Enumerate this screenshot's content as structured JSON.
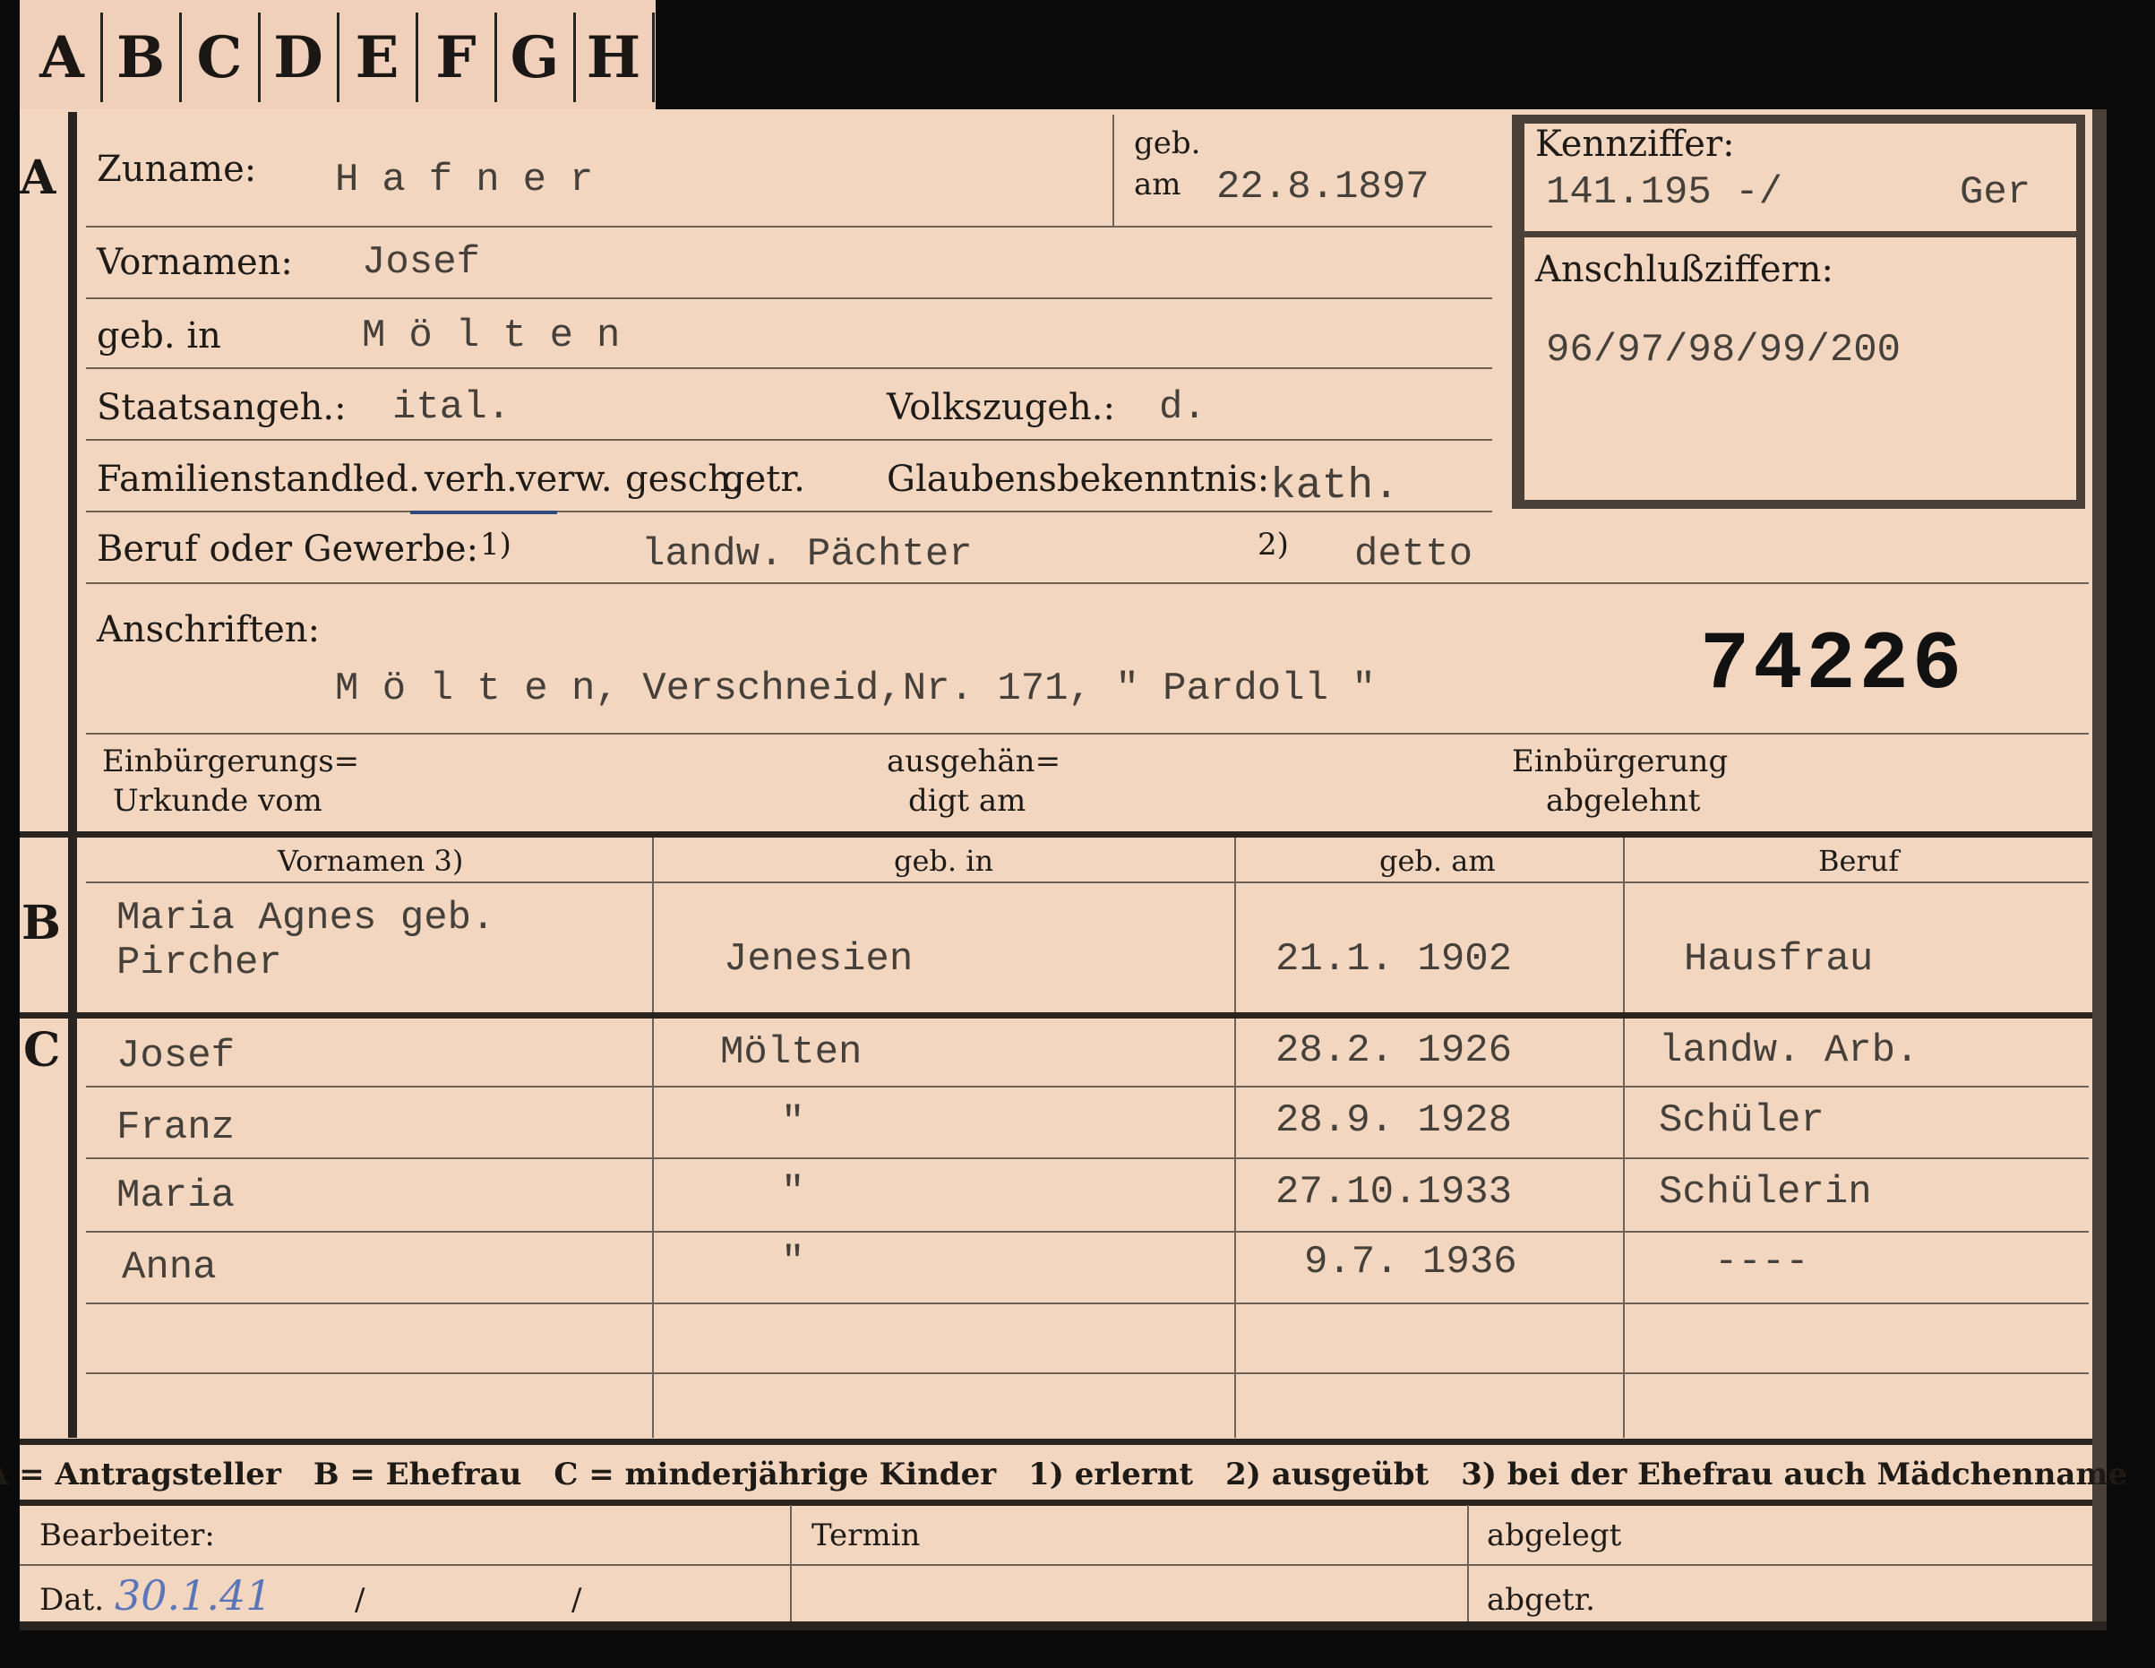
{
  "tabs": [
    "A",
    "B",
    "C",
    "D",
    "E",
    "F",
    "G",
    "H"
  ],
  "sections": {
    "a": "A",
    "b": "B",
    "c": "C"
  },
  "applicant": {
    "zuname_label": "Zuname:",
    "zuname_value": "Hafner",
    "geb_label": "geb.",
    "am_label": "am",
    "geb_am_value": "22.8.1897",
    "vornamen_label": "Vornamen:",
    "vornamen_value": "Josef",
    "geb_in_label": "geb. in",
    "geb_in_value": "Mölten",
    "staatsangeh_label": "Staatsangeh.:",
    "staatsangeh_value": "ital.",
    "volkszugeh_label": "Volkszugeh.:",
    "volkszugeh_value": "d.",
    "familienstand_label": "Familienstand:",
    "familienstand_options": [
      "led.",
      "verh.",
      "verw.",
      "gesch.",
      "getr."
    ],
    "familienstand_selected": "verh.",
    "glaubens_label": "Glaubensbekenntnis:",
    "glaubens_value": "kath.",
    "beruf_label": "Beruf oder Gewerbe:",
    "beruf_mark1": "1)",
    "beruf_value1": "landw. Pächter",
    "beruf_mark2": "2)",
    "beruf_value2": "detto",
    "anschriften_label": "Anschriften:",
    "anschriften_value": "M ö l t e n, Verschneid,Nr. 171, \" Pardoll \"",
    "stamp_number": "74226",
    "einb_urkunde_label_1": "Einbürgerungs=",
    "einb_urkunde_label_2": "Urkunde vom",
    "ausgehaendigt_label_1": "ausgehän=",
    "ausgehaendigt_label_2": "digt am",
    "einb_abgelehnt_label_1": "Einbürgerung",
    "einb_abgelehnt_label_2": "abgelehnt"
  },
  "box": {
    "kennziffer_label": "Kennziffer:",
    "kennziffer_value": "141.195 -/",
    "kennziffer_suffix": "Ger",
    "anschluss_label": "Anschlußziffern:",
    "anschluss_value": "96/97/98/99/200"
  },
  "table": {
    "headers": [
      "Vornamen 3)",
      "geb. in",
      "geb. am",
      "Beruf"
    ],
    "spouse": {
      "vornamen_1": "Maria Agnes geb.",
      "vornamen_2": "Pircher",
      "geb_in": "Jenesien",
      "geb_am": "21.1. 1902",
      "beruf": "Hausfrau"
    },
    "children": [
      {
        "vornamen": "Josef",
        "geb_in": "Mölten",
        "geb_am": "28.2. 1926",
        "beruf": "landw. Arb."
      },
      {
        "vornamen": "Franz",
        "geb_in": "\"",
        "geb_am": "28.9. 1928",
        "beruf": "Schüler"
      },
      {
        "vornamen": "Maria",
        "geb_in": "\"",
        "geb_am": "27.10.1933",
        "beruf": "Schülerin"
      },
      {
        "vornamen": "Anna",
        "geb_in": "\"",
        "geb_am": "9.7. 1936",
        "beruf": "----"
      }
    ]
  },
  "legend": {
    "a": "A = Antragsteller",
    "b": "B = Ehefrau",
    "c": "C = minderjährige Kinder",
    "n1": "1) erlernt",
    "n2": "2) ausgeübt",
    "n3": "3) bei der Ehefrau auch Mädchenname"
  },
  "footer": {
    "bearbeiter_label": "Bearbeiter:",
    "termin_label": "Termin",
    "abgelegt_label": "abgelegt",
    "dat_label": "Dat.",
    "dat_value": "30.1.41",
    "slash_1": "/",
    "slash_2": "/",
    "abgetr_label": "abgetr."
  }
}
